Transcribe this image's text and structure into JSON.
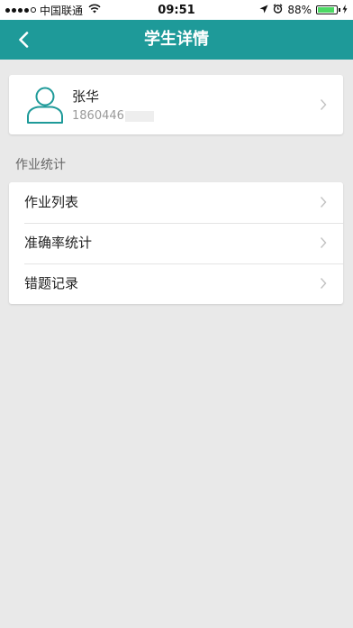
{
  "status_bar": {
    "carrier": "中国联通",
    "time": "09:51",
    "battery_percent": "88%",
    "battery_level": 0.88,
    "signal_bars_filled": 4,
    "icons": [
      "wifi-icon",
      "location-arrow-icon",
      "alarm-icon",
      "battery-icon",
      "charging-icon"
    ]
  },
  "header": {
    "title": "学生详情",
    "back_icon": "back-chevron-icon",
    "bg_color": "#1e9a99"
  },
  "profile": {
    "name": "张华",
    "phone_visible": "1860446",
    "avatar_icon": "user-outline-icon",
    "accent_color": "#1e9a99"
  },
  "section": {
    "title": "作业统计"
  },
  "menu": {
    "items": [
      {
        "label": "作业列表"
      },
      {
        "label": "准确率统计"
      },
      {
        "label": "错题记录"
      }
    ]
  }
}
